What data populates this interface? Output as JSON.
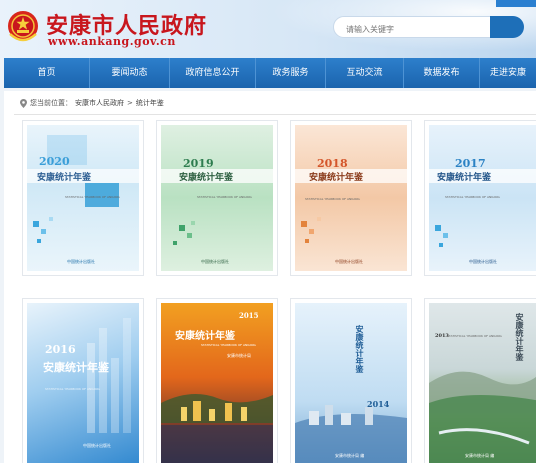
{
  "header": {
    "site_title": "安康市人民政府",
    "site_url": "www.ankang.gov.cn",
    "search_placeholder": "请输入关键字"
  },
  "nav": {
    "items": [
      "首页",
      "要闻动态",
      "政府信息公开",
      "政务服务",
      "互动交流",
      "数据发布",
      "走进安康"
    ]
  },
  "breadcrumb": {
    "prefix": "您当前位置：",
    "home": "安康市人民政府",
    "separator": ">",
    "current": "统计年鉴"
  },
  "yearbooks": [
    {
      "year_label": "2020",
      "title": "安康统计年鉴",
      "en": "STATISTICAL YEARBOOK OF ANKANG",
      "publisher": "中国统计出版社"
    },
    {
      "year_label": "2019",
      "title": "安康统计年鉴",
      "en": "STATISTICAL YEARBOOK OF ANKANG",
      "publisher": "中国统计出版社"
    },
    {
      "year_label": "2018",
      "title": "安康统计年鉴",
      "en": "STATISTICAL YEARBOOK OF ANKANG",
      "publisher": "中国统计出版社"
    },
    {
      "year_label": "2017",
      "title": "安康统计年鉴",
      "en": "STATISTICAL YEARBOOK OF ANKANG",
      "publisher": "中国统计出版社"
    },
    {
      "year_label": "2016",
      "title": "安康统计年鉴",
      "en": "STATISTICAL YEARBOOK OF ANKANG",
      "publisher": "中国统计出版社"
    },
    {
      "year_label": "2015",
      "title": "安康统计年鉴",
      "en": "STATISTICAL YEARBOOK OF ANKANG",
      "publisher": "安康市统计局"
    },
    {
      "year_label": "2014",
      "title": "安康统计年鉴",
      "en": "",
      "publisher": "安康市统计局 编"
    },
    {
      "year_label": "2013",
      "title": "安康统计年鉴",
      "en": "STATISTICAL YEARBOOK OF ANKANG",
      "publisher": "安康市统计局 编"
    }
  ]
}
